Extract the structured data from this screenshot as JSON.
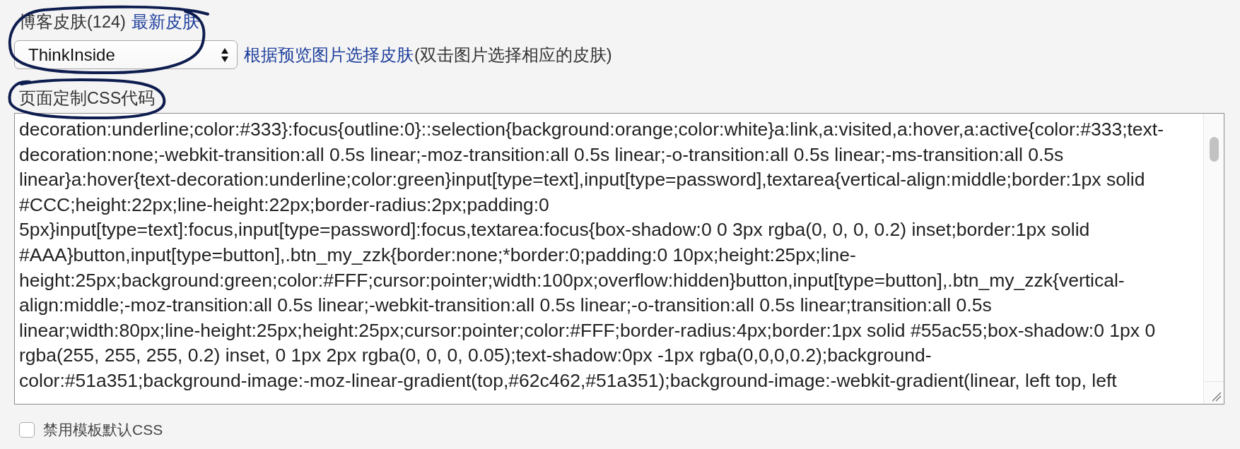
{
  "skin": {
    "label": "博客皮肤(124)",
    "link": "最新皮肤",
    "circled": true,
    "select": {
      "value": "ThinkInside"
    },
    "hint_link": "根据预览图片选择皮肤",
    "hint_note": "(双击图片选择相应的皮肤)"
  },
  "custom_css": {
    "label": "页面定制CSS代码",
    "circled": true,
    "lines": [
      "decoration:underline;color:#333}:focus{outline:0}::selection{background:orange;color:white}a:link,a:visited,a:hover,a:active{color:#333;text-",
      "decoration:none;-webkit-transition:all 0.5s linear;-moz-transition:all 0.5s linear;-o-transition:all 0.5s linear;-ms-transition:all 0.5s",
      "linear}a:hover{text-decoration:underline;color:green}input[type=text],input[type=password],textarea{vertical-align:middle;border:1px solid",
      "#CCC;height:22px;line-height:22px;border-radius:2px;padding:0",
      "5px}input[type=text]:focus,input[type=password]:focus,textarea:focus{box-shadow:0 0 3px rgba(0, 0, 0, 0.2) inset;border:1px solid",
      "#AAA}button,input[type=button],.btn_my_zzk{border:none;*border:0;padding:0 10px;height:25px;line-",
      "height:25px;background:green;color:#FFF;cursor:pointer;width:100px;overflow:hidden}button,input[type=button],.btn_my_zzk{vertical-",
      "align:middle;-moz-transition:all 0.5s linear;-webkit-transition:all 0.5s linear;-o-transition:all 0.5s linear;transition:all 0.5s",
      "linear;width:80px;line-height:25px;height:25px;cursor:pointer;color:#FFF;border-radius:4px;border:1px solid #55ac55;box-shadow:0 1px 0",
      "rgba(255, 255, 255, 0.2) inset, 0 1px 2px rgba(0, 0, 0, 0.05);text-shadow:0px -1px rgba(0,0,0,0.2);background-",
      "color:#51a351;background-image:-moz-linear-gradient(top,#62c462,#51a351);background-image:-webkit-gradient(linear, left top, left"
    ]
  },
  "disable_default_css": {
    "label": "禁用模板默认CSS",
    "checked": false
  }
}
